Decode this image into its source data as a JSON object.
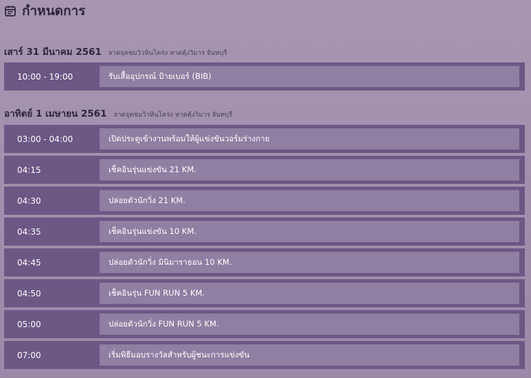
{
  "header": {
    "title": "กำหนดการ",
    "icon": "calendar-icon"
  },
  "days": [
    {
      "date": "เสาร์ 31 มีนาคม 2561",
      "venue": "ลาดจุดชมวิวหินโคร่ง หาดคุ้งวิมาร จันทบุรี",
      "events": [
        {
          "time": "10:00 - 19:00",
          "desc": "รับเสื้ออุปกรณ์ ป้ายเบอร์ (BIB)"
        }
      ]
    },
    {
      "date": "อาทิตย์ 1 เมษายน 2561",
      "venue": "ลาดจุดชมวิวหินโคร่ง หาดคุ้งวิมาร จันทบุรี",
      "events": [
        {
          "time": "03:00 - 04:00",
          "desc": "เปิดประตูเข้างานพร้อมให้ผู้แข่งขันวอร์มร่างกาย"
        },
        {
          "time": "04:15",
          "desc": "เช็คอินรุ่นแข่งขัน 21 KM."
        },
        {
          "time": "04:30",
          "desc": "ปล่อยตัวนักวิ่ง 21 KM."
        },
        {
          "time": "04:35",
          "desc": "เช็คอินรุ่นแข่งขัน 10 KM."
        },
        {
          "time": "04:45",
          "desc": "ปล่อยตัวนักวิ่ง มินิมาราธอน 10 KM."
        },
        {
          "time": "04:50",
          "desc": "เช็คอินรุ่น FUN RUN 5 KM."
        },
        {
          "time": "05:00",
          "desc": "ปล่อยตัวนักวิ่ง FUN RUN 5 KM."
        },
        {
          "time": "07:00",
          "desc": "เริ่มพิธีมอบรางวัลสำหรับผู้ชนะการแข่งขัน"
        }
      ]
    }
  ]
}
